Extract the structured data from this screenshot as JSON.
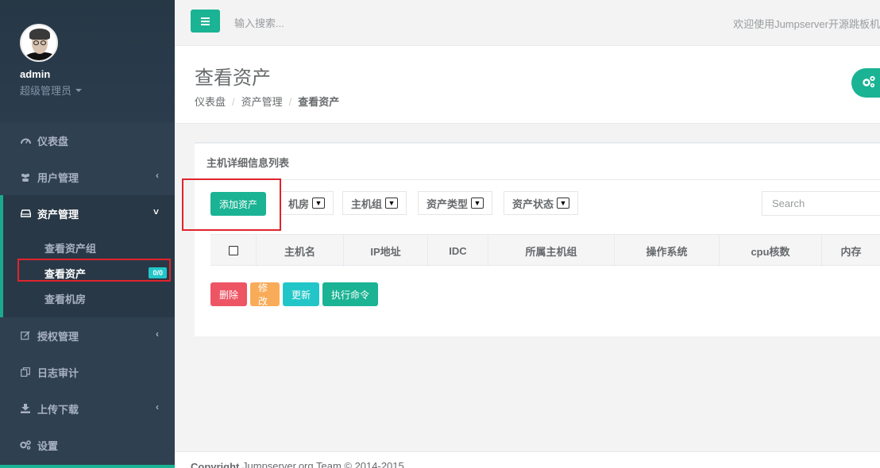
{
  "sidebar": {
    "profile": {
      "name": "admin",
      "role": "超级管理员"
    },
    "nav": [
      {
        "label": "仪表盘",
        "icon": "dashboard-icon"
      },
      {
        "label": "用户管理",
        "icon": "users-icon",
        "arrow": "‹"
      },
      {
        "label": "资产管理",
        "icon": "hdd-icon",
        "arrow": "˅"
      },
      {
        "label": "授权管理",
        "icon": "edit-icon",
        "arrow": "‹"
      },
      {
        "label": "日志审计",
        "icon": "copy-icon"
      },
      {
        "label": "上传下载",
        "icon": "download-icon",
        "arrow": "‹"
      },
      {
        "label": "设置",
        "icon": "cogs-icon"
      }
    ],
    "submenu": [
      {
        "label": "查看资产组"
      },
      {
        "label": "查看资产",
        "badge": "0/0"
      },
      {
        "label": "查看机房"
      }
    ]
  },
  "topbar": {
    "search_placeholder": "输入搜索...",
    "welcome": "欢迎使用Jumpserver开源跳板机"
  },
  "header": {
    "title": "查看资产",
    "breadcrumb": [
      "仪表盘",
      "资产管理",
      "查看资产"
    ]
  },
  "ibox": {
    "title": "主机详细信息列表",
    "add_button": "添加资产",
    "filters": [
      "机房",
      "主机组",
      "资产类型",
      "资产状态"
    ],
    "search_placeholder": "Search",
    "columns": [
      "主机名",
      "IP地址",
      "IDC",
      "所属主机组",
      "操作系统",
      "cpu核数",
      "内存"
    ],
    "actions": [
      {
        "label": "删除",
        "color": "#ed5565"
      },
      {
        "label": "修改",
        "color": "#f8ac59"
      },
      {
        "label": "更新",
        "color": "#23c6c8"
      },
      {
        "label": "执行命令",
        "color": "#1ab394"
      }
    ]
  },
  "footer": {
    "copyright_label": "Copyright",
    "text": "Jumpserver.org Team © 2014-2015"
  },
  "colors": {
    "accent": "#1ab394",
    "sidebar": "#2f4050",
    "highlight": "#e0242b"
  }
}
